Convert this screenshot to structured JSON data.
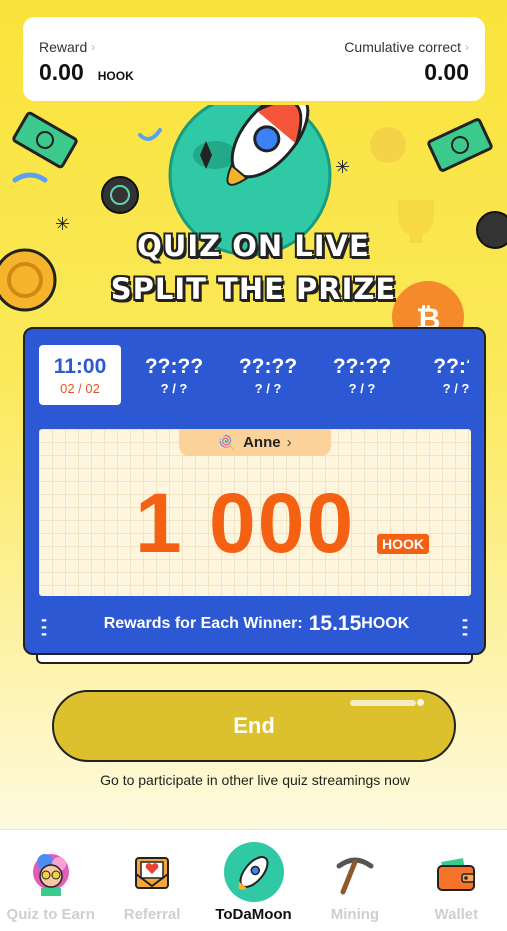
{
  "stats": {
    "reward_label": "Reward",
    "reward_value": "0.00",
    "reward_unit": "HOOK",
    "cumulative_label": "Cumulative correct",
    "cumulative_value": "0.00"
  },
  "hero": {
    "title_line1": "QUIZ ON LIVE",
    "title_line2": "SPLIT THE PRIZE"
  },
  "sessions": [
    {
      "time": "11:00",
      "date": "02 / 02",
      "active": true
    },
    {
      "time": "??:??",
      "date": "? / ?",
      "active": false
    },
    {
      "time": "??:??",
      "date": "? / ?",
      "active": false
    },
    {
      "time": "??:??",
      "date": "? / ?",
      "active": false
    },
    {
      "time": "??:?",
      "date": "? / ?",
      "active": false
    }
  ],
  "prize": {
    "host_name": "Anne",
    "amount": "1 000",
    "unit": "HOOK"
  },
  "winner": {
    "label": "Rewards for Each Winner:",
    "value": "15.15",
    "unit": "HOOK"
  },
  "end_button": {
    "label": "End"
  },
  "hint": "Go to participate in other live quiz streamings now",
  "nav": [
    {
      "label": "Quiz to Earn",
      "icon": "quiz-avatar-icon"
    },
    {
      "label": "Referral",
      "icon": "heart-envelope-icon"
    },
    {
      "label": "ToDaMoon",
      "icon": "rocket-icon"
    },
    {
      "label": "Mining",
      "icon": "pickaxe-icon"
    },
    {
      "label": "Wallet",
      "icon": "wallet-icon"
    }
  ],
  "colors": {
    "accent_blue": "#2c58d3",
    "prize_orange": "#f46112",
    "end_button": "#dcc02d",
    "background_yellow": "#f9e33a"
  }
}
